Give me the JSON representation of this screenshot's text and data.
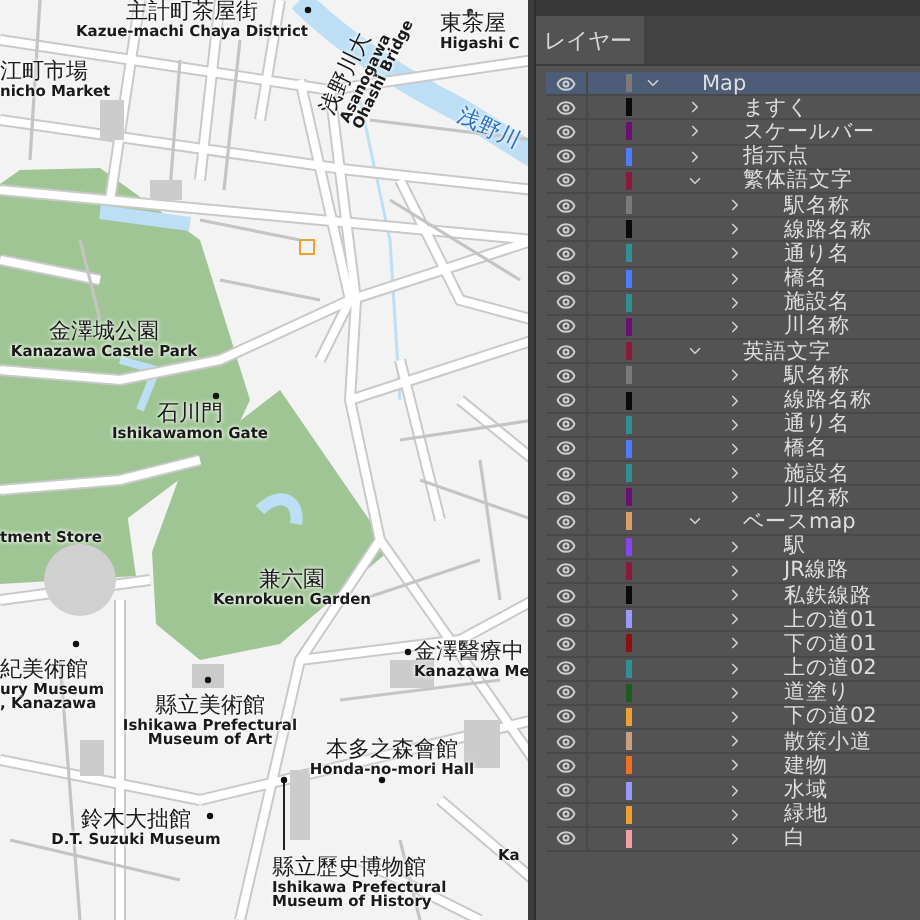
{
  "map": {
    "labels": [
      {
        "ja": "主計町茶屋街",
        "en": [
          "Kazue-machi Chaya District"
        ]
      },
      {
        "ja": "東茶屋",
        "en": [
          "Higashi C"
        ]
      },
      {
        "ja": "江町市場",
        "en": [
          "nicho Market"
        ]
      },
      {
        "ja": "浅野川大",
        "en": [
          "Asanogawa",
          "Ohashi Bridge"
        ]
      },
      {
        "ja": "浅野川"
      },
      {
        "ja": "金澤城公園",
        "en": [
          "Kanazawa Castle Park"
        ]
      },
      {
        "ja": "石川門",
        "en": [
          "Ishikawamon Gate"
        ]
      },
      {
        "en": [
          "tment Store"
        ]
      },
      {
        "ja": "兼六園",
        "en": [
          "Kenrokuen Garden"
        ]
      },
      {
        "ja": "紀美術館",
        "en": [
          "ury Museum",
          ", Kanazawa"
        ]
      },
      {
        "ja": "縣立美術館",
        "en": [
          "Ishikawa Prefectural",
          "Museum of Art"
        ]
      },
      {
        "ja": "金澤醫療中",
        "en": [
          "Kanazawa Me"
        ]
      },
      {
        "ja": "本多之森會館",
        "en": [
          "Honda-no-mori Hall"
        ]
      },
      {
        "ja": "鈴木大拙館",
        "en": [
          "D.T. Suzuki Museum"
        ]
      },
      {
        "ja": "縣立歷史博物館",
        "en": [
          "Ishikawa Prefectural",
          "Museum of History"
        ]
      },
      {
        "en": [
          "Ka"
        ]
      }
    ]
  },
  "panel": {
    "tab": "レイヤー",
    "layers": [
      {
        "name": "Map",
        "color": "#7a7a7a",
        "visible": true,
        "selected": true,
        "expanded": true,
        "children": [
          {
            "name": "ますく",
            "color": "#0a0a0a",
            "visible": true,
            "selected": false,
            "expanded": false
          },
          {
            "name": "スケールバー",
            "color": "#6a1070",
            "visible": true,
            "selected": false,
            "expanded": false
          },
          {
            "name": "指示点",
            "color": "#4f7bff",
            "visible": true,
            "selected": false,
            "expanded": false
          },
          {
            "name": "繁体語文字",
            "color": "#8b1a3a",
            "visible": true,
            "selected": false,
            "expanded": true,
            "children": [
              {
                "name": "駅名称",
                "color": "#7a7a7a",
                "visible": true,
                "selected": false,
                "expanded": false
              },
              {
                "name": "線路名称",
                "color": "#0a0a0a",
                "visible": true,
                "selected": false,
                "expanded": false
              },
              {
                "name": "通り名",
                "color": "#2e9090",
                "visible": true,
                "selected": false,
                "expanded": false
              },
              {
                "name": "橋名",
                "color": "#4f7bff",
                "visible": true,
                "selected": false,
                "expanded": false
              },
              {
                "name": "施設名",
                "color": "#2e9090",
                "visible": true,
                "selected": false,
                "expanded": false
              },
              {
                "name": "川名称",
                "color": "#6a1070",
                "visible": true,
                "selected": false,
                "expanded": false
              }
            ]
          },
          {
            "name": "英語文字",
            "color": "#8b1a3a",
            "visible": true,
            "selected": false,
            "expanded": true,
            "children": [
              {
                "name": "駅名称",
                "color": "#7a7a7a",
                "visible": true,
                "selected": false,
                "expanded": false
              },
              {
                "name": "線路名称",
                "color": "#0a0a0a",
                "visible": true,
                "selected": false,
                "expanded": false
              },
              {
                "name": "通り名",
                "color": "#2e9090",
                "visible": true,
                "selected": false,
                "expanded": false
              },
              {
                "name": "橋名",
                "color": "#4f7bff",
                "visible": true,
                "selected": false,
                "expanded": false
              },
              {
                "name": "施設名",
                "color": "#2e9090",
                "visible": true,
                "selected": false,
                "expanded": false
              },
              {
                "name": "川名称",
                "color": "#6a1070",
                "visible": true,
                "selected": false,
                "expanded": false
              }
            ]
          },
          {
            "name": "ベースmap",
            "color": "#d9a06a",
            "visible": true,
            "selected": false,
            "expanded": true,
            "children": [
              {
                "name": "駅",
                "color": "#8844ee",
                "visible": true,
                "selected": false,
                "expanded": false
              },
              {
                "name": "JR線路",
                "color": "#8b1a3a",
                "visible": true,
                "selected": false,
                "expanded": false
              },
              {
                "name": "私鉄線路",
                "color": "#0a0a0a",
                "visible": true,
                "selected": false,
                "expanded": false
              },
              {
                "name": "上の道01",
                "color": "#9999ff",
                "visible": true,
                "selected": false,
                "expanded": false
              },
              {
                "name": "下の道01",
                "color": "#8b1010",
                "visible": true,
                "selected": false,
                "expanded": false
              },
              {
                "name": "上の道02",
                "color": "#2e9090",
                "visible": true,
                "selected": false,
                "expanded": false
              },
              {
                "name": "道塗り",
                "color": "#1f5a1f",
                "visible": true,
                "selected": false,
                "expanded": false
              },
              {
                "name": "下の道02",
                "color": "#f0a030",
                "visible": true,
                "selected": false,
                "expanded": false
              },
              {
                "name": "散策小道",
                "color": "#c8a080",
                "visible": true,
                "selected": false,
                "expanded": false
              },
              {
                "name": "建物",
                "color": "#f07020",
                "visible": true,
                "selected": false,
                "expanded": false
              },
              {
                "name": "水域",
                "color": "#9999ff",
                "visible": true,
                "selected": false,
                "expanded": false
              },
              {
                "name": "緑地",
                "color": "#f0a030",
                "visible": true,
                "selected": false,
                "expanded": false
              },
              {
                "name": "白",
                "color": "#f0a0a8",
                "visible": true,
                "selected": false,
                "expanded": false
              }
            ]
          }
        ]
      }
    ]
  }
}
